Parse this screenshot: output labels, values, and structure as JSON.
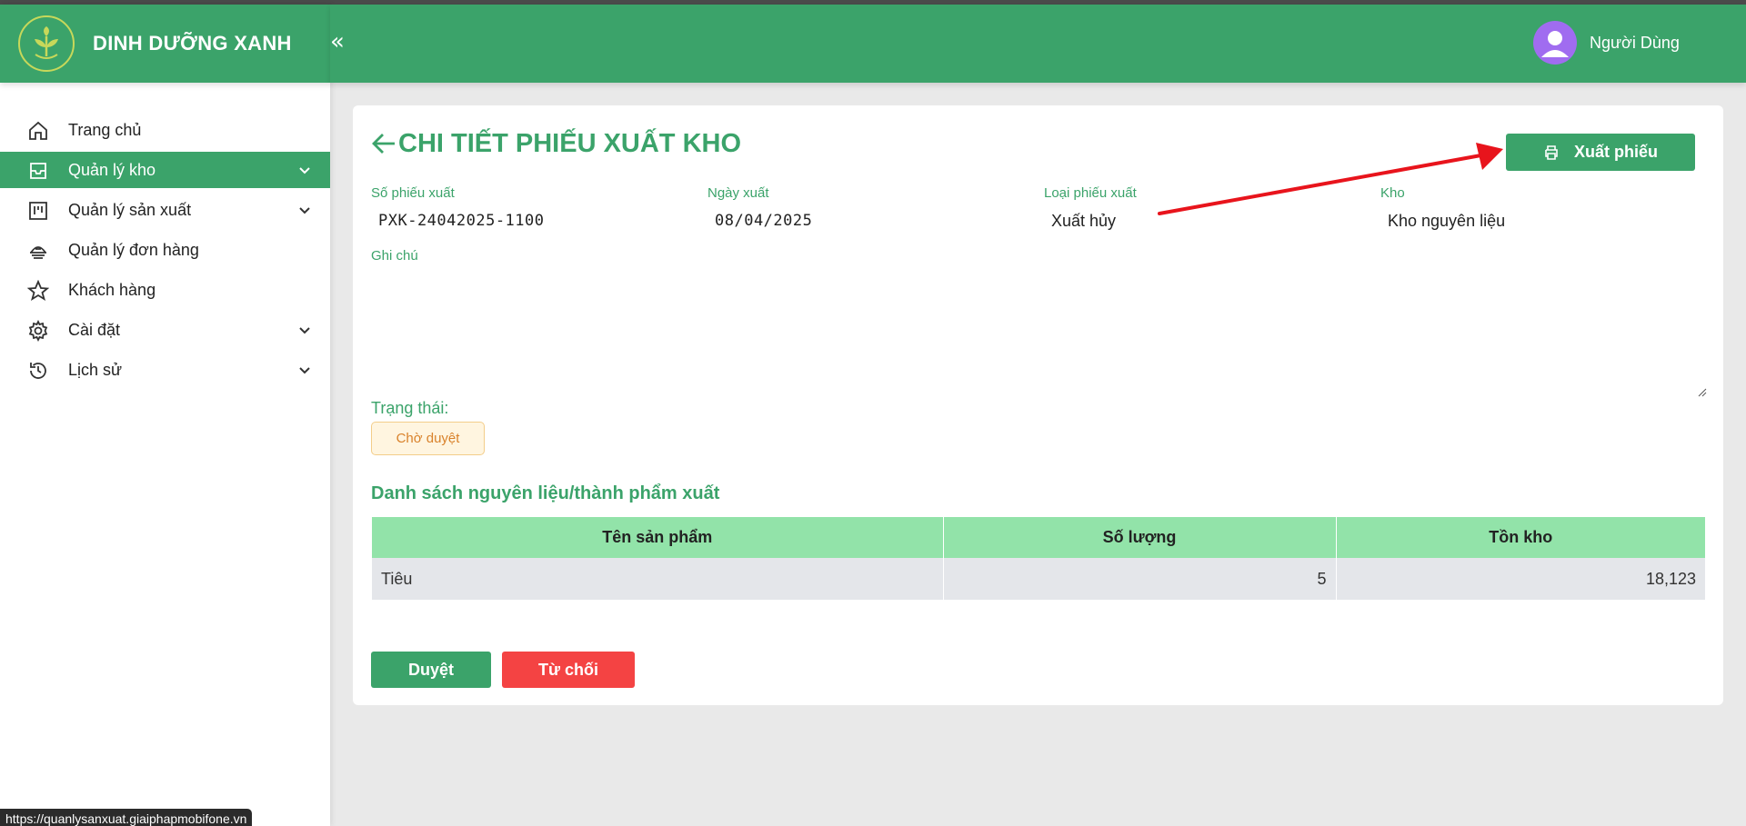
{
  "brand": {
    "name": "DINH DƯỠNG XANH"
  },
  "header": {
    "collapse_glyph": "«",
    "user_name": "Người Dùng"
  },
  "sidebar": {
    "items": [
      {
        "label": "Trang chủ",
        "icon": "home-icon",
        "has_submenu": false,
        "active": false
      },
      {
        "label": "Quản lý kho",
        "icon": "inbox-icon",
        "has_submenu": true,
        "active": true
      },
      {
        "label": "Quản lý sản xuất",
        "icon": "factory-icon",
        "has_submenu": true,
        "active": false
      },
      {
        "label": "Quản lý đơn hàng",
        "icon": "order-icon",
        "has_submenu": false,
        "active": false
      },
      {
        "label": "Khách hàng",
        "icon": "star-icon",
        "has_submenu": false,
        "active": false
      },
      {
        "label": "Cài đặt",
        "icon": "gear-icon",
        "has_submenu": true,
        "active": false
      },
      {
        "label": "Lịch sử",
        "icon": "history-icon",
        "has_submenu": true,
        "active": false
      }
    ]
  },
  "page": {
    "title": "CHI TIẾT PHIẾU XUẤT KHO",
    "export_button": "Xuất phiếu",
    "fields": {
      "so_phieu": {
        "label": "Số phiếu xuất",
        "value": "PXK-24042025-1100"
      },
      "ngay_xuat": {
        "label": "Ngày xuất",
        "value": "08/04/2025"
      },
      "loai_phieu": {
        "label": "Loại phiếu xuất",
        "value": "Xuất hủy"
      },
      "kho": {
        "label": "Kho",
        "value": "Kho nguyên liệu"
      }
    },
    "note": {
      "label": "Ghi chú",
      "value": ""
    },
    "status": {
      "label": "Trạng thái:",
      "value": "Chờ duyệt"
    },
    "section_title": "Danh sách nguyên liệu/thành phẩm xuất",
    "table": {
      "headers": [
        "Tên sản phẩm",
        "Số lượng",
        "Tồn kho"
      ],
      "rows": [
        {
          "name": "Tiêu",
          "quantity": "5",
          "stock": "18,123"
        }
      ]
    },
    "approve_button": "Duyệt",
    "reject_button": "Từ chối"
  },
  "colors": {
    "primary": "#3ba36a",
    "danger": "#f44343",
    "table_header": "#92e3a9",
    "status_text": "#d9822b",
    "annotation_arrow": "#e8141c"
  },
  "status_bar": {
    "url": "https://quanlysanxuat.giaiphapmobifone.vn"
  }
}
